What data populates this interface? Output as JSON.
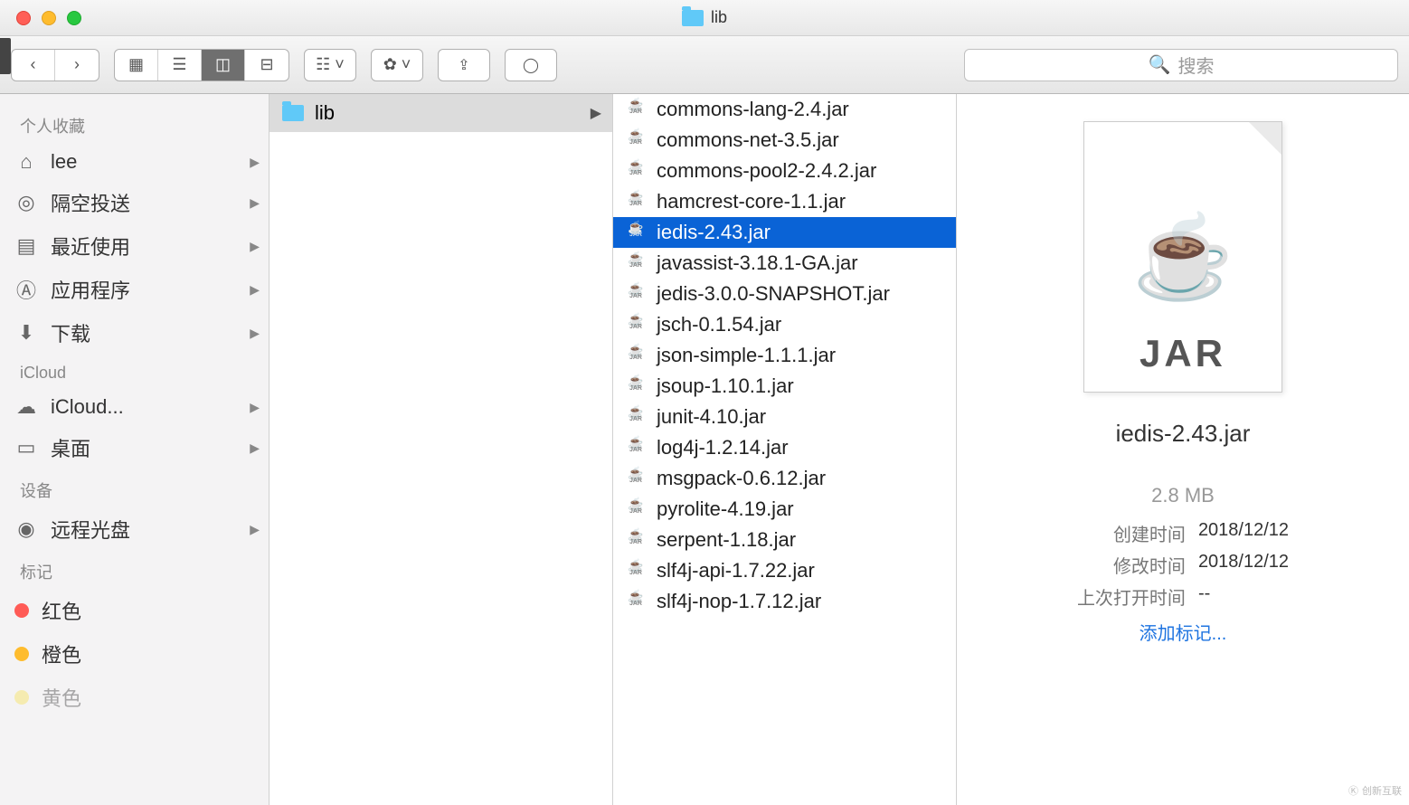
{
  "window": {
    "title": "lib"
  },
  "toolbar": {
    "search_placeholder": "搜索"
  },
  "sidebar": {
    "sections": [
      {
        "label": "个人收藏",
        "items": [
          {
            "icon": "home",
            "label": "lee"
          },
          {
            "icon": "airdrop",
            "label": "隔空投送"
          },
          {
            "icon": "recent",
            "label": "最近使用"
          },
          {
            "icon": "apps",
            "label": "应用程序"
          },
          {
            "icon": "downloads",
            "label": "下载"
          }
        ]
      },
      {
        "label": "iCloud",
        "items": [
          {
            "icon": "cloud",
            "label": "iCloud..."
          },
          {
            "icon": "desktop",
            "label": "桌面"
          }
        ]
      },
      {
        "label": "设备",
        "items": [
          {
            "icon": "disc",
            "label": "远程光盘"
          }
        ]
      },
      {
        "label": "标记",
        "items": [
          {
            "icon": "dot-red",
            "label": "红色"
          },
          {
            "icon": "dot-orange",
            "label": "橙色"
          },
          {
            "icon": "dot-yellow",
            "label": "黄色"
          }
        ]
      }
    ]
  },
  "column1": {
    "folder": "lib"
  },
  "files": [
    "commons-lang-2.4.jar",
    "commons-net-3.5.jar",
    "commons-pool2-2.4.2.jar",
    "hamcrest-core-1.1.jar",
    "iedis-2.43.jar",
    "javassist-3.18.1-GA.jar",
    "jedis-3.0.0-SNAPSHOT.jar",
    "jsch-0.1.54.jar",
    "json-simple-1.1.1.jar",
    "jsoup-1.10.1.jar",
    "junit-4.10.jar",
    "log4j-1.2.14.jar",
    "msgpack-0.6.12.jar",
    "pyrolite-4.19.jar",
    "serpent-1.18.jar",
    "slf4j-api-1.7.22.jar",
    "slf4j-nop-1.7.12.jar"
  ],
  "selected_index": 4,
  "preview": {
    "name": "iedis-2.43.jar",
    "doc_label": "JAR",
    "size": "2.8 MB",
    "created_label": "创建时间",
    "created_value": "2018/12/12",
    "modified_label": "修改时间",
    "modified_value": "2018/12/12",
    "opened_label": "上次打开时间",
    "opened_value": "--",
    "add_tag": "添加标记..."
  },
  "watermark": "创新互联"
}
